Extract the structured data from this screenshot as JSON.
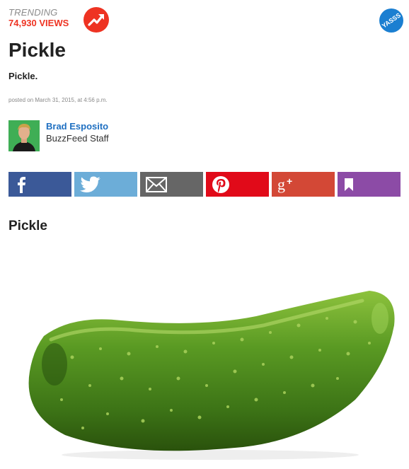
{
  "trending": {
    "label": "TRENDING",
    "views": "74,930 VIEWS",
    "badge_icon": "trending-arrow-icon"
  },
  "yasss_badge": {
    "text": "YASSS"
  },
  "article": {
    "title": "Pickle",
    "dek": "Pickle.",
    "posted": "posted on March 31, 2015, at 4:56 p.m."
  },
  "author": {
    "name": "Brad Esposito",
    "role": "BuzzFeed Staff"
  },
  "share_buttons": [
    {
      "network": "facebook",
      "icon": "facebook-icon",
      "color": "#3b5998"
    },
    {
      "network": "twitter",
      "icon": "twitter-icon",
      "color": "#6cadd8"
    },
    {
      "network": "email",
      "icon": "email-icon",
      "color": "#666666"
    },
    {
      "network": "pinterest",
      "icon": "pinterest-icon",
      "color": "#e10a19"
    },
    {
      "network": "google-plus",
      "icon": "google-plus-icon",
      "color": "#d34836"
    },
    {
      "network": "bookmark",
      "icon": "bookmark-icon",
      "color": "#8c4ba6"
    }
  ],
  "sections": [
    {
      "heading": "Pickle",
      "image": "pickle-photo"
    }
  ]
}
